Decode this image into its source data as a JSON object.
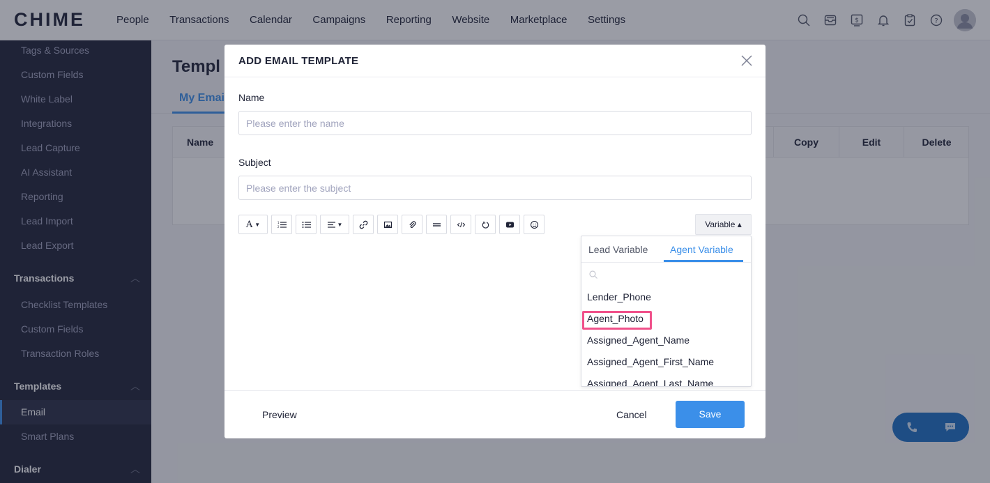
{
  "app": {
    "logo": "CHIME",
    "nav": [
      "People",
      "Transactions",
      "Calendar",
      "Campaigns",
      "Reporting",
      "Website",
      "Marketplace",
      "Settings"
    ]
  },
  "sidebar": {
    "items_top": [
      "Tags & Sources",
      "Custom Fields",
      "White Label",
      "Integrations",
      "Lead Capture",
      "AI Assistant",
      "Reporting",
      "Lead Import",
      "Lead Export"
    ],
    "transactions_section": "Transactions",
    "transactions_items": [
      "Checklist Templates",
      "Custom Fields",
      "Transaction Roles"
    ],
    "templates_section": "Templates",
    "templates_items": [
      "Email",
      "Smart Plans"
    ],
    "dialer_section": "Dialer"
  },
  "main": {
    "title": "Templ",
    "tab": "My Emai",
    "columns": {
      "name": "Name",
      "copy": "Copy",
      "edit": "Edit",
      "delete": "Delete"
    }
  },
  "modal": {
    "title": "ADD EMAIL TEMPLATE",
    "name_label": "Name",
    "name_placeholder": "Please enter the name",
    "subject_label": "Subject",
    "subject_placeholder": "Please enter the subject",
    "variable_button": "Variable ▴",
    "dropdown": {
      "tabs": [
        "Lead Variable",
        "Agent Variable"
      ],
      "active_tab": "Agent Variable",
      "items": [
        "Lender_Phone",
        "Agent_Photo",
        "Assigned_Agent_Name",
        "Assigned_Agent_First_Name",
        "Assigned_Agent_Last_Name"
      ],
      "highlighted": "Agent_Photo"
    },
    "footer": {
      "preview": "Preview",
      "cancel": "Cancel",
      "save": "Save"
    }
  },
  "colors": {
    "accent": "#3b8fe9",
    "sidebar_bg": "#202437",
    "highlight": "#f0508a"
  }
}
